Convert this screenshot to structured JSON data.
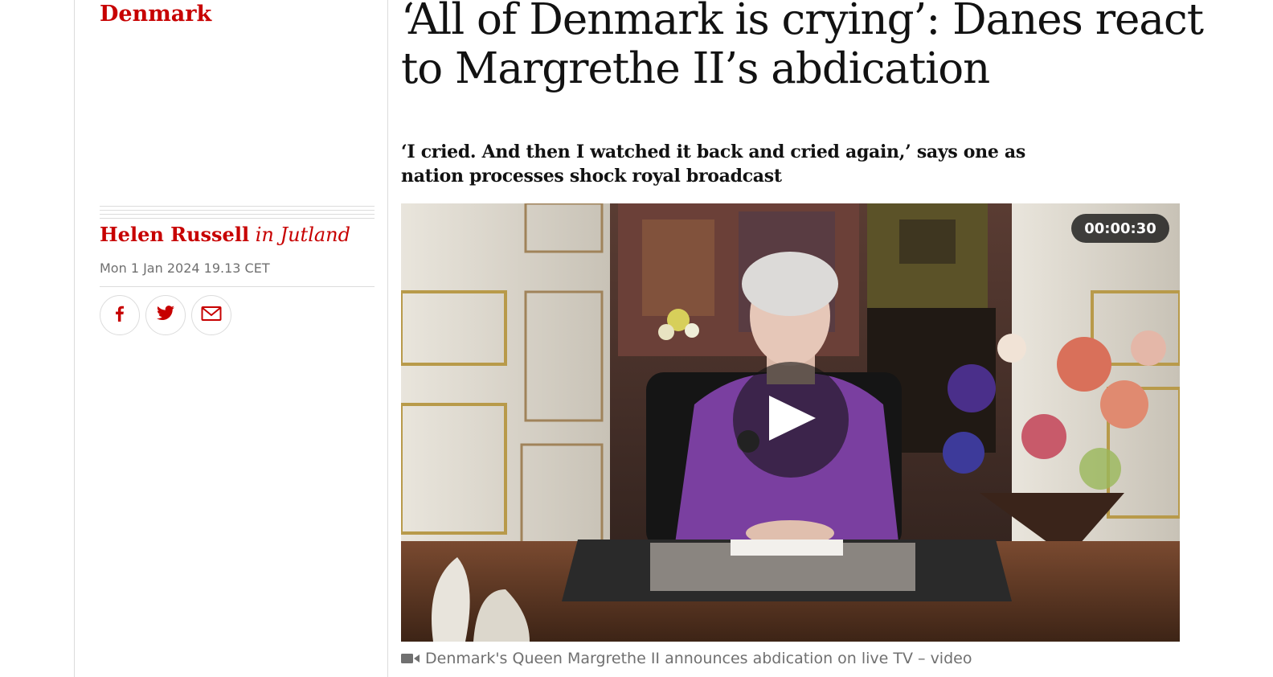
{
  "section": {
    "label": "Denmark"
  },
  "byline": {
    "author": "Helen Russell",
    "location": "in Jutland"
  },
  "dateline": "Mon 1 Jan 2024 19.13 CET",
  "share": [
    {
      "icon": "facebook-icon"
    },
    {
      "icon": "twitter-icon"
    },
    {
      "icon": "email-icon"
    }
  ],
  "headline": "‘All of Denmark is crying’: Danes react to Margrethe II’s abdication",
  "standfirst": "‘I cried. And then I watched it back and cried again,’ says one as nation processes shock royal broadcast",
  "video": {
    "duration": "00:00:30",
    "caption": "Denmark's Queen Margrethe II announces abdication on live TV – video"
  },
  "colors": {
    "section": "#c70000",
    "text": "#121212",
    "muted": "#707070",
    "rule": "#dcdcdc"
  }
}
